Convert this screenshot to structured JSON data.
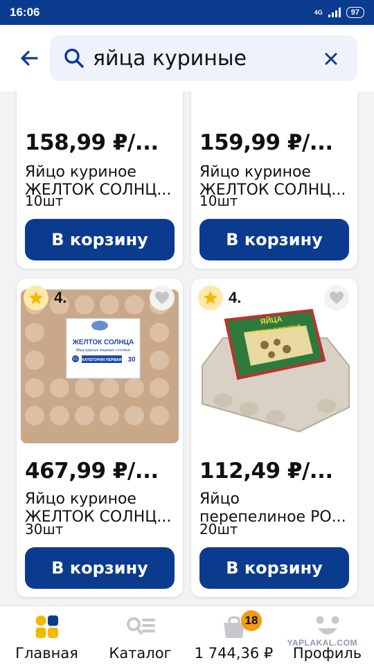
{
  "status_bar": {
    "time": "16:06",
    "network": "4G",
    "battery": "97"
  },
  "search": {
    "query": "яйца куриные"
  },
  "products": [
    {
      "price": "158,99 ₽/...",
      "name_line1": "Яйцо куриное",
      "name_line2": "ЖЕЛТОК СОЛНЦ...",
      "qty": "10шт",
      "cart_label": "В корзину"
    },
    {
      "price": "159,99 ₽/...",
      "name_line1": "Яйцо куриное",
      "name_line2": "ЖЕЛТОК СОЛНЦ...",
      "qty": "10шт",
      "cart_label": "В корзину"
    },
    {
      "price": "467,99 ₽/...",
      "name_line1": "Яйцо куриное",
      "name_line2": "ЖЕЛТОК СОЛНЦ...",
      "qty": "30шт",
      "cart_label": "В корзину",
      "rating": "4.",
      "package_text": {
        "brand": "ЖЕЛТОК СОЛНЦА",
        "subtitle": "Яйца куриные пищевые столовые",
        "category": "КАТЕГОРИЯ ПЕРВАЯ",
        "count": "30",
        "grade": "С1"
      }
    },
    {
      "price": "112,49 ₽/...",
      "name_line1": "Яйцо",
      "name_line2": "перепелиное РО...",
      "qty": "20шт",
      "cart_label": "В корзину",
      "rating": "4.",
      "package_text": {
        "brand": "ЯЙЦА",
        "subtitle": "ПЕРЕПЕЛИНЫЕ ПИЩЕВЫЕ"
      }
    }
  ],
  "bottom_nav": {
    "items": [
      {
        "label": "Главная",
        "icon": "home-grid-icon",
        "active": true
      },
      {
        "label": "Каталог",
        "icon": "catalog-icon"
      },
      {
        "label": "1 744,36 ₽",
        "icon": "cart-bag-icon",
        "badge": "18"
      },
      {
        "label": "Профиль",
        "icon": "profile-face-icon"
      }
    ],
    "watermark": "YAPLAKAL.COM"
  },
  "colors": {
    "brand_blue": "#0b3b8f",
    "accent_yellow": "#f5b800",
    "badge_orange": "#f39b12"
  }
}
